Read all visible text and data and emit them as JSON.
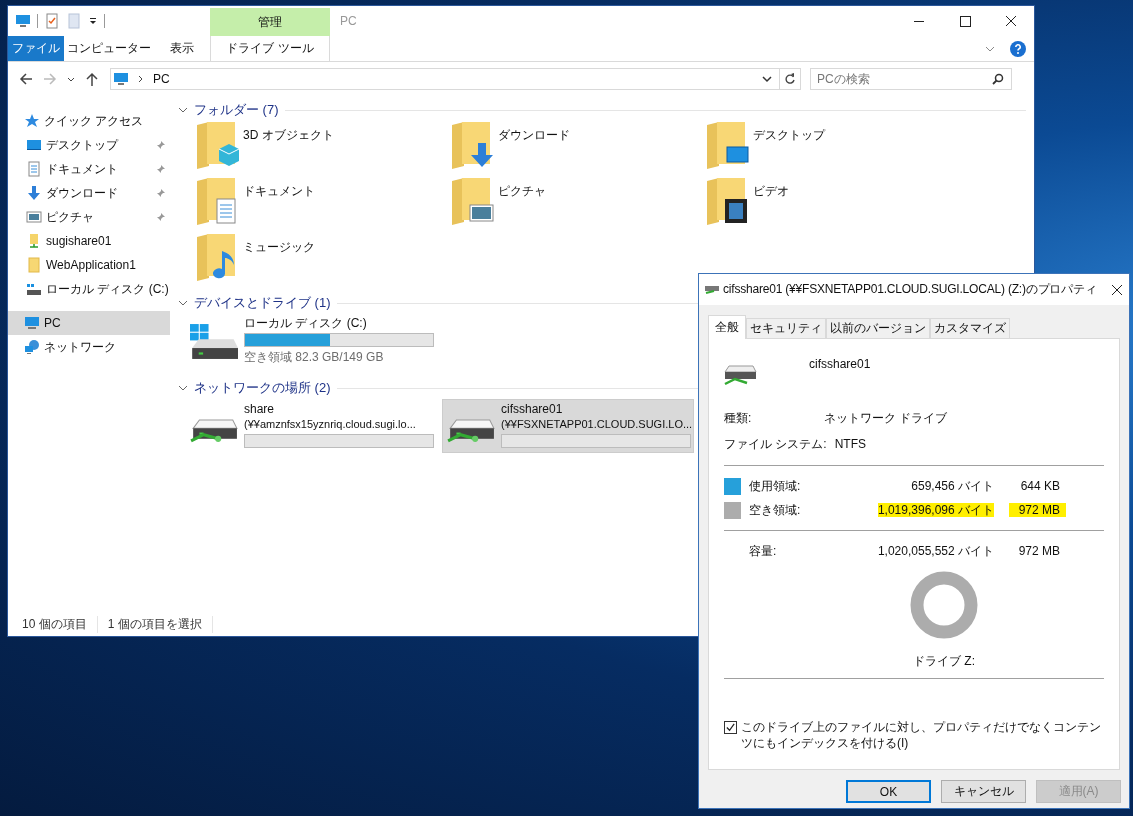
{
  "explorer": {
    "title": "PC",
    "context_group": "管理",
    "ribbon_tabs": [
      {
        "label": "ファイル",
        "kind": "file",
        "selected": false
      },
      {
        "label": "コンピューター",
        "kind": "normal",
        "selected": false
      },
      {
        "label": "表示",
        "kind": "normal",
        "selected": false
      },
      {
        "label": "ドライブ ツール",
        "kind": "contextual",
        "selected": false
      }
    ],
    "address": "PC",
    "search": {
      "placeholder": "PCの検索"
    },
    "sidebar": {
      "items": [
        {
          "label": "クイック アクセス",
          "selected": false,
          "children": [
            {
              "label": "デスクトップ",
              "pinned": true,
              "selected": false
            },
            {
              "label": "ドキュメント",
              "pinned": true,
              "selected": false
            },
            {
              "label": "ダウンロード",
              "pinned": true,
              "selected": false
            },
            {
              "label": "ピクチャ",
              "pinned": true,
              "selected": false
            },
            {
              "label": "sugishare01",
              "pinned": false,
              "selected": false
            },
            {
              "label": "WebApplication1",
              "pinned": false,
              "selected": false
            },
            {
              "label": "ローカル ディスク (C:)",
              "pinned": false,
              "selected": false
            }
          ]
        },
        {
          "label": "PC",
          "selected": true
        },
        {
          "label": "ネットワーク",
          "selected": false
        }
      ]
    },
    "sections": [
      {
        "title": "フォルダー (7)",
        "kind": "folders",
        "expanded": true,
        "items": [
          {
            "label": "3D オブジェクト"
          },
          {
            "label": "ダウンロード"
          },
          {
            "label": "デスクトップ"
          },
          {
            "label": "ドキュメント"
          },
          {
            "label": "ピクチャ"
          },
          {
            "label": "ビデオ"
          },
          {
            "label": "ミュージック"
          }
        ]
      },
      {
        "title": "デバイスとドライブ (1)",
        "kind": "drives",
        "expanded": true,
        "items": [
          {
            "name": "ローカル ディスク (C:)",
            "level": 0.45,
            "detail": "空き領域 82.3 GB/149 GB",
            "selected": false
          }
        ]
      },
      {
        "title": "ネットワークの場所 (2)",
        "kind": "drives",
        "expanded": true,
        "items": [
          {
            "name": "share",
            "path": "(¥¥amznfsx15yznriq.cloud.sugi.lo...",
            "selected": false
          },
          {
            "name": "cifsshare01",
            "path": "(¥¥FSXNETAPP01.CLOUD.SUGI.LO...",
            "selected": true
          }
        ]
      }
    ],
    "status_bar": [
      "10 個の項目",
      "1 個の項目を選択"
    ]
  },
  "dialog": {
    "title": "cifsshare01 (¥¥FSXNETAPP01.CLOUD.SUGI.LOCAL) (Z:)のプロパティ",
    "tabs": [
      {
        "label": "全般",
        "selected": true
      },
      {
        "label": "セキュリティ",
        "selected": false
      },
      {
        "label": "以前のバージョン",
        "selected": false
      },
      {
        "label": "カスタマイズ",
        "selected": false
      }
    ],
    "drive_name": "cifsshare01",
    "info": [
      {
        "label": "種類:",
        "value": "ネットワーク ドライブ"
      },
      {
        "label": "ファイル システム:",
        "value": "NTFS"
      }
    ],
    "usage": [
      {
        "label": "使用領域:",
        "bytes": "659,456 バイト",
        "size": "644 KB",
        "color": "#26a0da",
        "highlighted": false
      },
      {
        "label": "空き領域:",
        "bytes": "1,019,396,096 バイト",
        "size": "972 MB",
        "color": "#acacac",
        "highlighted": true
      }
    ],
    "capacity": {
      "label": "容量:",
      "bytes": "1,020,055,552 バイト",
      "size": "972 MB"
    },
    "drive_label": "ドライブ Z:",
    "index_option": {
      "label": "このドライブ上のファイルに対し、プロパティだけでなくコンテンツにもインデックスを付ける(I)",
      "checked": true
    },
    "buttons": [
      {
        "label": "OK",
        "kind": "default",
        "disabled": false
      },
      {
        "label": "キャンセル",
        "kind": "normal",
        "disabled": false
      },
      {
        "label": "適用(A)",
        "kind": "normal",
        "disabled": true
      }
    ]
  }
}
